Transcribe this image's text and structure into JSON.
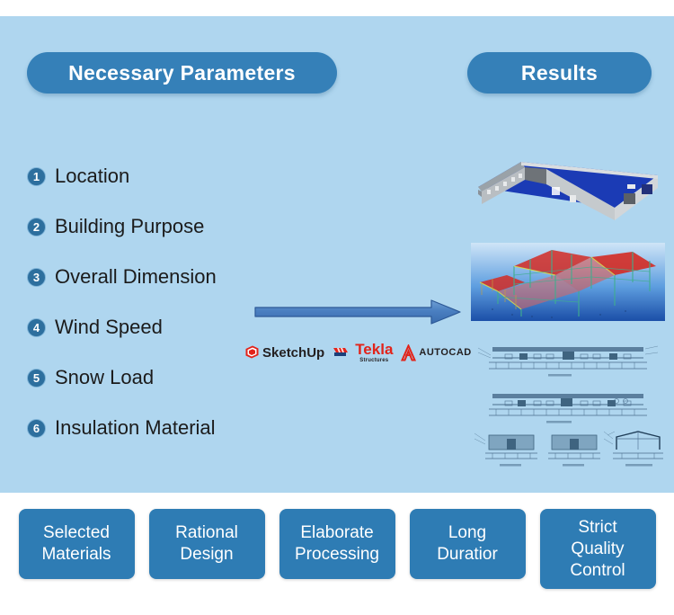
{
  "panel": {
    "background_color": "#afd6ef"
  },
  "headers": {
    "parameters_title": "Necessary Parameters",
    "results_title": "Results",
    "pill_color": "#3580b8"
  },
  "parameters": {
    "items": [
      {
        "number": "1",
        "label": "Location"
      },
      {
        "number": "2",
        "label": "Building Purpose"
      },
      {
        "number": "3",
        "label": "Overall Dimension"
      },
      {
        "number": "4",
        "label": "Wind Speed"
      },
      {
        "number": "5",
        "label": "Snow Load"
      },
      {
        "number": "6",
        "label": "Insulation Material"
      }
    ],
    "badge_color": "#2d6f9e"
  },
  "arrow": {
    "direction": "right",
    "color": "#4a7fc1"
  },
  "software": [
    {
      "name": "SketchUp",
      "icon": "sketchup-logo-icon",
      "color": "#e2231a"
    },
    {
      "name": "Tekla",
      "subtitle": "Structures",
      "icon": "tekla-logo-icon",
      "color": "#e2231a"
    },
    {
      "name": "AUTOCAD",
      "icon": "autocad-logo-icon",
      "color": "#e2231a"
    }
  ],
  "results": [
    {
      "id": "building-render",
      "caption": "3D warehouse render with blue roof and grey cladding"
    },
    {
      "id": "steel-frame-model",
      "caption": "3D steel structure frame model"
    },
    {
      "id": "cad-drawings",
      "caption": "CAD elevation and section drawings"
    }
  ],
  "features": [
    {
      "lines": [
        "Selected",
        "Materials"
      ]
    },
    {
      "lines": [
        "Rational",
        "Design"
      ]
    },
    {
      "lines": [
        "Elaborate",
        "Processing"
      ]
    },
    {
      "lines": [
        "Long",
        "Duratior"
      ]
    },
    {
      "lines": [
        "Strict",
        "Quality",
        "Control"
      ]
    }
  ],
  "feature_color": "#2e7cb4"
}
